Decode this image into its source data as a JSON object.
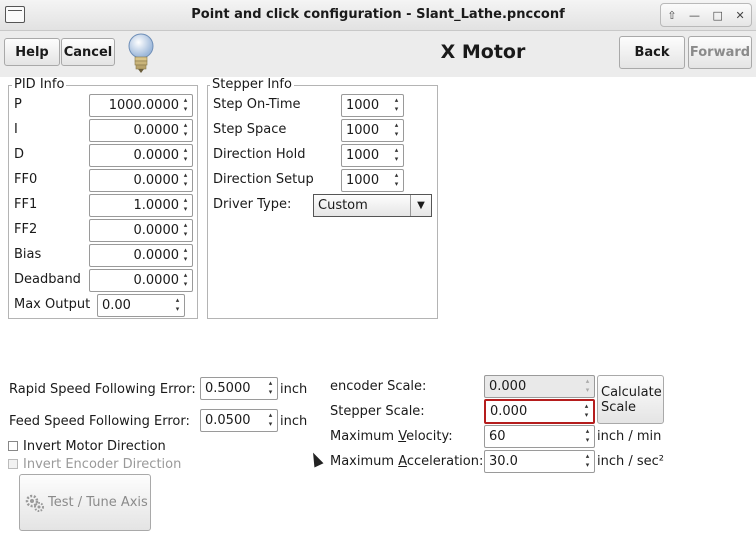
{
  "window": {
    "title": "Point and click configuration - Slant_Lathe.pncconf",
    "controls": [
      "up-icon",
      "minimize-icon",
      "maximize-icon",
      "close-icon"
    ]
  },
  "header": {
    "help_label": "Help",
    "cancel_label": "Cancel",
    "page_title": "X Motor",
    "back_label": "Back",
    "forward_label": "Forward"
  },
  "pid": {
    "legend": "PID Info",
    "rows": [
      {
        "label": "P",
        "value": "1000.0000"
      },
      {
        "label": "I",
        "value": "0.0000"
      },
      {
        "label": "D",
        "value": "0.0000"
      },
      {
        "label": "FF0",
        "value": "0.0000"
      },
      {
        "label": "FF1",
        "value": "1.0000"
      },
      {
        "label": "FF2",
        "value": "0.0000"
      },
      {
        "label": "Bias",
        "value": "0.0000"
      },
      {
        "label": "Deadband",
        "value": "0.0000"
      }
    ],
    "max_output_label": "Max Output",
    "max_output_value": "0.00"
  },
  "stepper": {
    "legend": "Stepper Info",
    "rows": [
      {
        "label": "Step On-Time",
        "value": "1000"
      },
      {
        "label": "Step Space",
        "value": "1000"
      },
      {
        "label": "Direction Hold",
        "value": "1000"
      },
      {
        "label": "Direction Setup",
        "value": "1000"
      }
    ],
    "driver_type_label": "Driver Type:",
    "driver_type_value": "Custom"
  },
  "following": {
    "rapid_label": "Rapid Speed Following Error:",
    "rapid_value": "0.5000",
    "rapid_unit": "inch",
    "feed_label": "Feed Speed Following Error:",
    "feed_value": "0.0500",
    "feed_unit": "inch"
  },
  "options": {
    "invert_motor_label": "Invert Motor Direction",
    "invert_encoder_label": "Invert Encoder Direction"
  },
  "test_button_label": "Test / Tune Axis",
  "scale": {
    "encoder_label": "encoder Scale:",
    "encoder_value": "0.000",
    "stepper_label": "Stepper Scale:",
    "stepper_value": "0.000",
    "calc_label_1": "Calculate",
    "calc_label_2": "Scale",
    "velocity_label_pre": "Maximum ",
    "velocity_label_u": "V",
    "velocity_label_post": "elocity:",
    "velocity_value": "60",
    "velocity_unit": "inch / min",
    "accel_label_pre": "Maximum ",
    "accel_label_u": "A",
    "accel_label_post": "cceleration:",
    "accel_value": "30.0",
    "accel_unit": "inch / sec²"
  }
}
